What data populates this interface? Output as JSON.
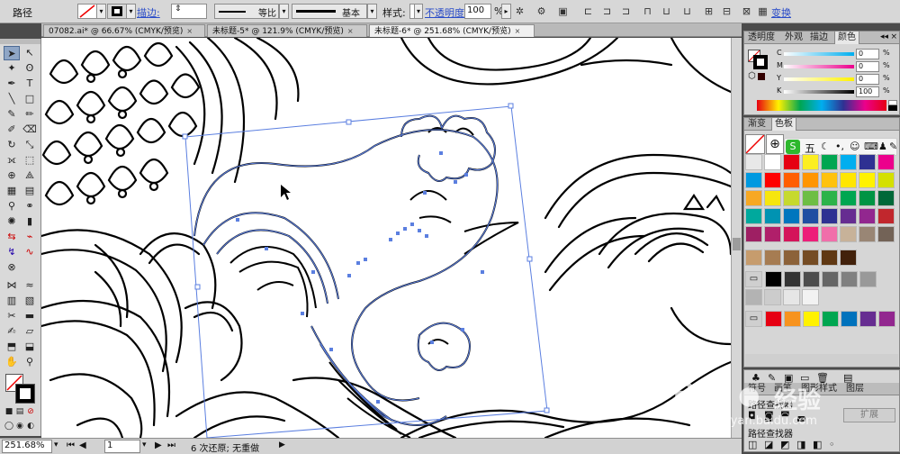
{
  "control_bar": {
    "selection_label": "路径",
    "stroke_label": "描边:",
    "stroke_profile": "等比",
    "brush": "基本",
    "style_label": "样式:",
    "opacity_label": "不透明度:",
    "opacity_value": "100",
    "percent": "%",
    "transform_label": "变换"
  },
  "document_tabs": [
    {
      "label": "07082.ai* @ 66.67% (CMYK/预览)"
    },
    {
      "label": "未标题-5* @ 121.9% (CMYK/预览)"
    },
    {
      "label": "未标题-6* @ 251.68% (CMYK/预览)"
    }
  ],
  "color_panel": {
    "tabs": [
      "透明度",
      "外观",
      "描边",
      "颜色"
    ],
    "channels": [
      {
        "name": "C",
        "value": "0"
      },
      {
        "name": "M",
        "value": "0"
      },
      {
        "name": "Y",
        "value": "0"
      },
      {
        "name": "K",
        "value": "100"
      }
    ],
    "percent": "%"
  },
  "swatches_panel": {
    "tabs": [
      "渐变",
      "色板"
    ],
    "ime_char": "五",
    "rows": [
      [
        "#e8e8e8",
        "#ffffff",
        "#e60012",
        "#fcee21",
        "#00a651",
        "#00aeef",
        "#2e3192",
        "#ec008c"
      ],
      [
        "#0099e0",
        "#ff0000",
        "#ff5e00",
        "#ff9500",
        "#ffc20e",
        "#ffe600",
        "#fff200",
        "#d4e000"
      ],
      [
        "#f7a823",
        "#f6e60e",
        "#c6d92e",
        "#6dbe45",
        "#2cb34a",
        "#00a651",
        "#009444",
        "#006838"
      ],
      [
        "#00a99d",
        "#0093b2",
        "#0076be",
        "#1f4ea2",
        "#2e3192",
        "#662d91",
        "#92278f",
        "#c1272d"
      ],
      [
        "#9e1f63",
        "#b01f6a",
        "#d4145a",
        "#ed1e79",
        "#f06eaa",
        "#c7b299",
        "#998675",
        "#736357"
      ],
      [
        "#c69c6d",
        "#a67c52",
        "#8c6239",
        "#754c24",
        "#603813",
        "#42210b"
      ],
      [
        "#000000",
        "#333333",
        "#4d4d4d",
        "#666666",
        "#808080",
        "#999999"
      ],
      [
        "#b3b3b3",
        "#cccccc",
        "#e6e6e6",
        "#f2f2f2"
      ],
      [
        "#e60012",
        "#f7931e",
        "#fff200",
        "#00a651",
        "#0072bc",
        "#662d91",
        "#92278f"
      ]
    ]
  },
  "bottom_panel": {
    "tabs": [
      "符号",
      "画笔",
      "图形样式",
      "图层"
    ],
    "item1": "路径查找器",
    "expand_label": "扩展",
    "item2": "路径查找器"
  },
  "status_bar": {
    "zoom": "251.68%",
    "page": "1",
    "history": "6 次还原; 无重做"
  },
  "watermark": {
    "brand": "Bai",
    "chinese": "经验",
    "url": "jingyan.baidu.com"
  }
}
